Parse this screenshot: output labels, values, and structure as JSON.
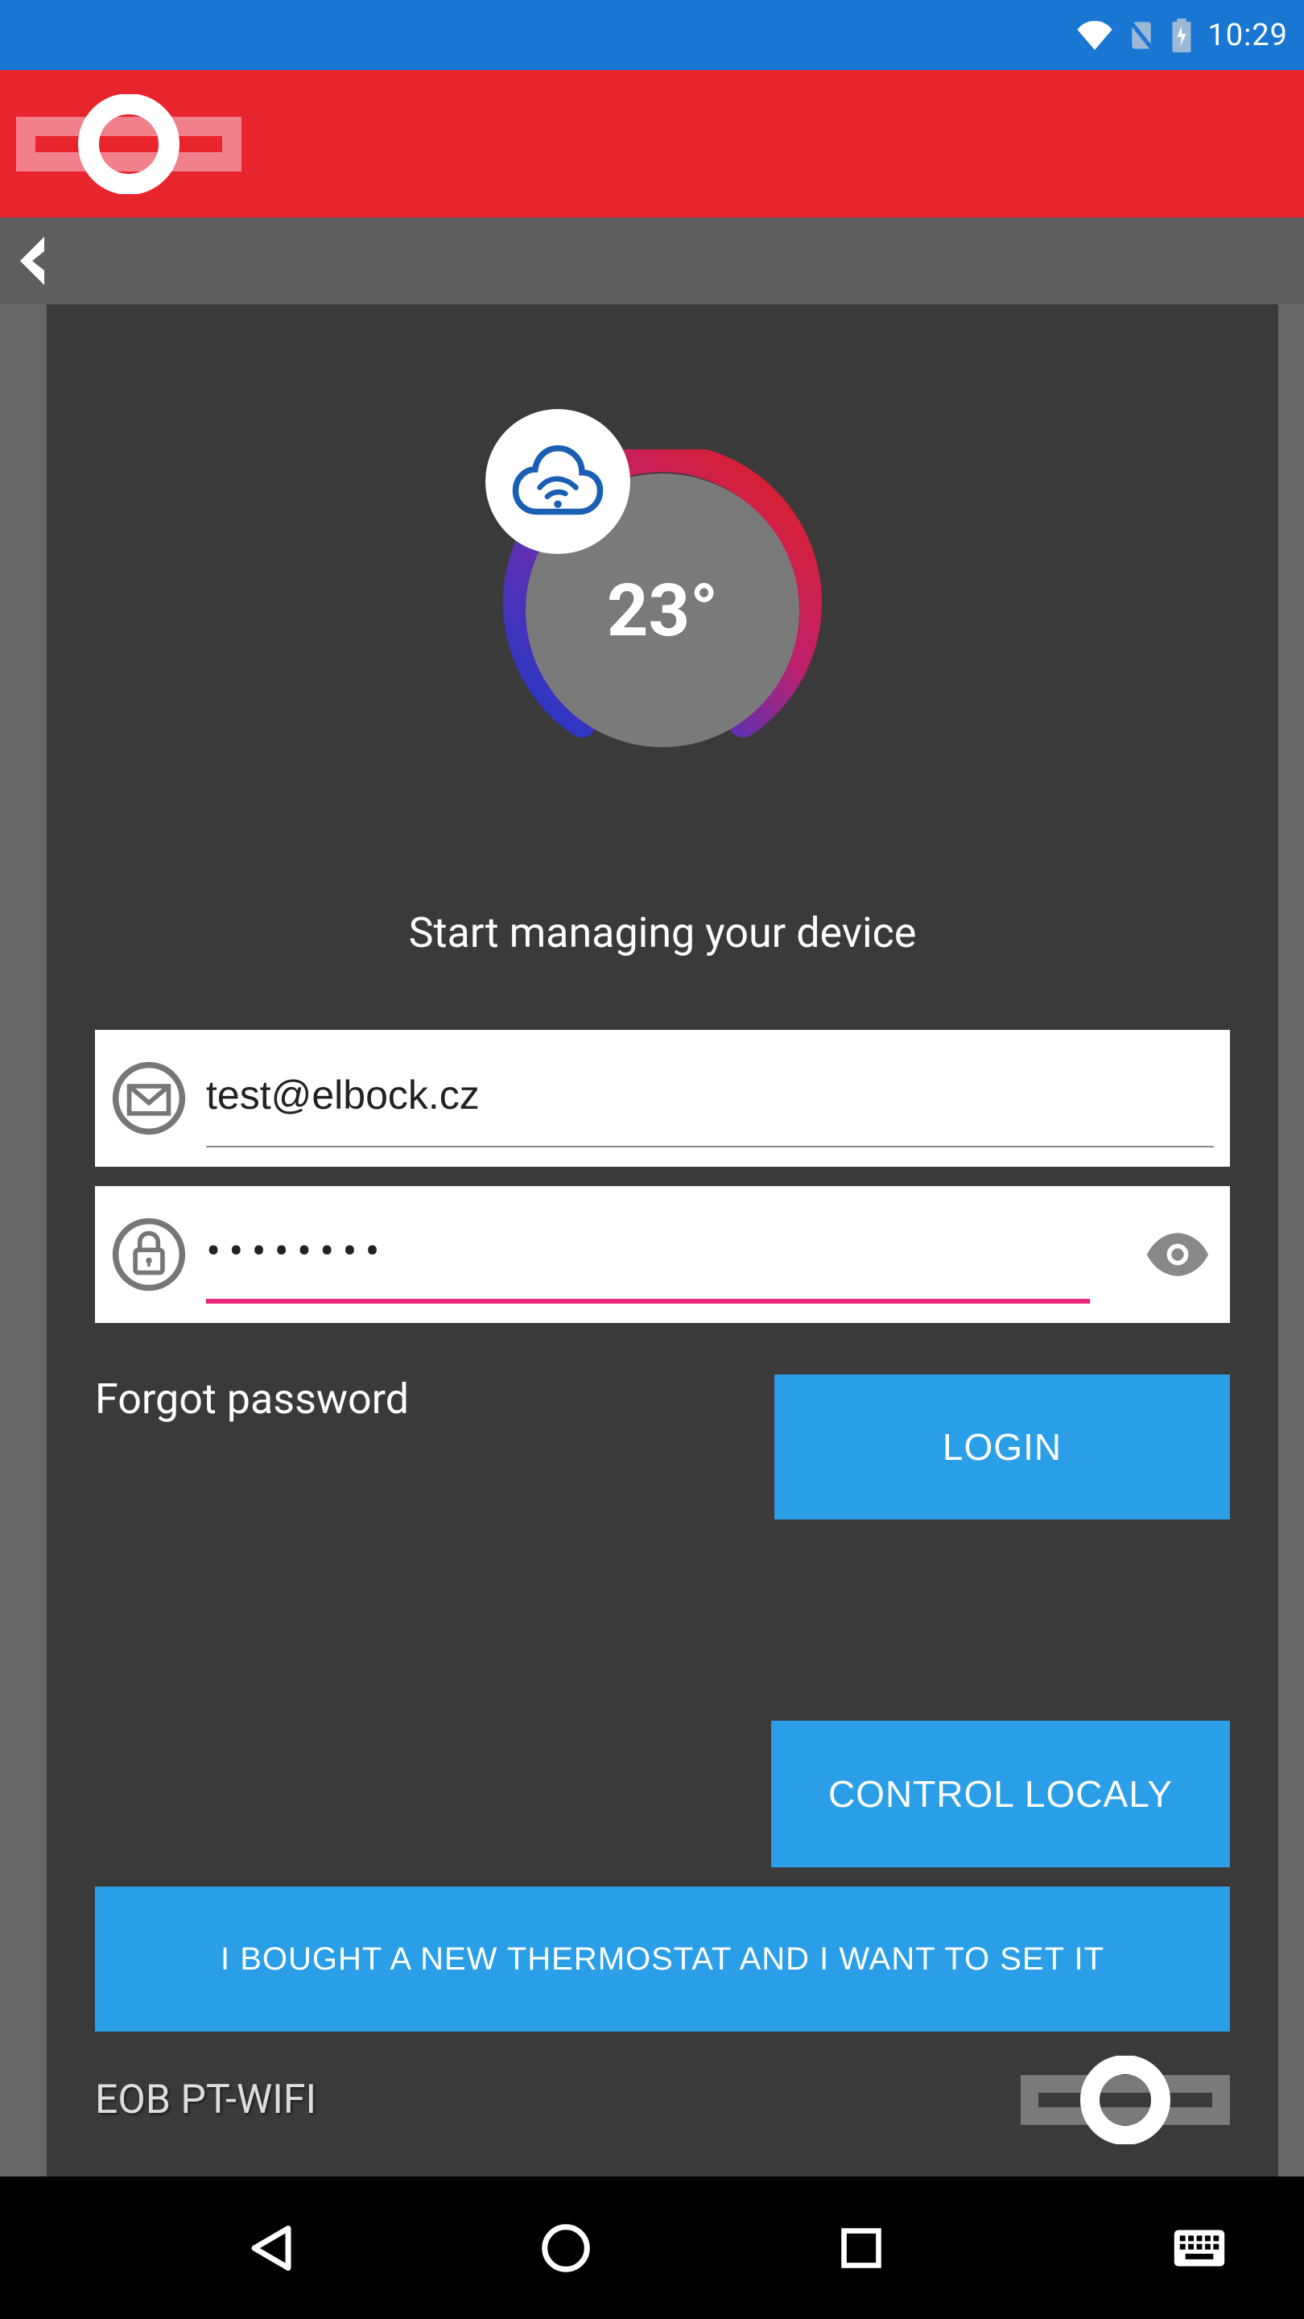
{
  "status": {
    "time": "10:29"
  },
  "thermo": {
    "temp": "23°"
  },
  "tagline": "Start managing your device",
  "form": {
    "email": "test@elbock.cz",
    "password": "••••••••"
  },
  "links": {
    "forgot": "Forgot password"
  },
  "buttons": {
    "login": "LOGIN",
    "control_local": "CONTROL LOCALY",
    "new_thermostat": "I BOUGHT A NEW THERMOSTAT AND I WANT TO SET IT"
  },
  "footer": {
    "app_name": "EOB PT-WIFI"
  }
}
